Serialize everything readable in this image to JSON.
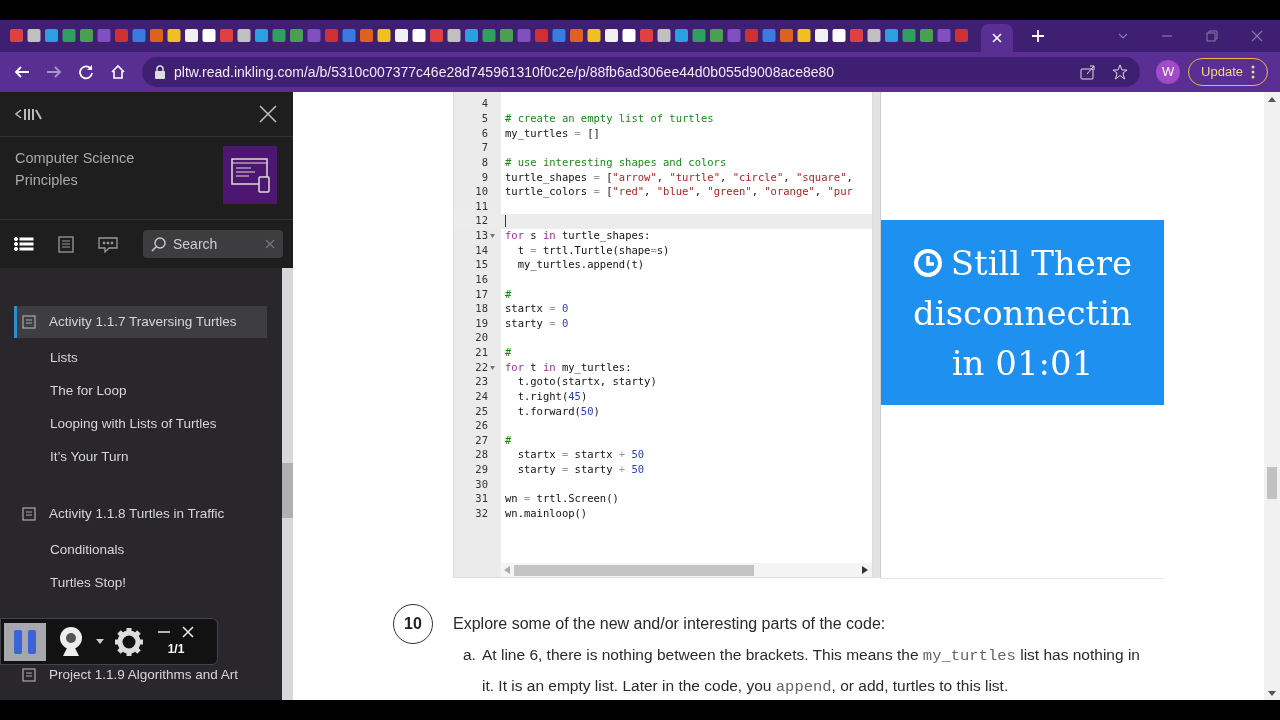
{
  "browser": {
    "address_bar": {
      "url": "pltw.read.inkling.com/a/b/5310c007377c46e28d745961310f0c2e/p/88fb6ad306ee44d0b055d9008ace8e80"
    },
    "profile": "W",
    "update_button": "Update"
  },
  "sidebar": {
    "title": "Computer Science Principles",
    "toolbar": [
      {
        "kind": "list",
        "selected": true
      },
      {
        "kind": "page",
        "selected": false
      },
      {
        "kind": "comment",
        "selected": false
      }
    ],
    "search": {
      "placeholder": "Search"
    },
    "toc": [
      {
        "title": "Activity 1.1.7 Traversing Turtles",
        "selected": true,
        "children": [
          {
            "title": "Lists"
          },
          {
            "title": "The for Loop"
          },
          {
            "title": "Looping with Lists of Turtles"
          },
          {
            "title": "It’s Your Turn"
          }
        ]
      },
      {
        "title": "Activity 1.1.8 Turtles in Traffic",
        "selected": false,
        "children": [
          {
            "title": "Conditionals"
          },
          {
            "title": "Turtles Stop!"
          }
        ]
      },
      {
        "title": "Project 1.1.9 Algorithms and Art",
        "selected": false
      }
    ]
  },
  "recorder": {
    "counter": "1/1"
  },
  "editor": {
    "lines": [
      {
        "number": "4",
        "current": false,
        "foldable": false
      },
      {
        "number": "5",
        "current": false,
        "foldable": false,
        "tokens": [
          {
            "kind": "comment",
            "text": "# create an empty list of turtles"
          }
        ]
      },
      {
        "number": "6",
        "current": false,
        "foldable": false,
        "tokens": [
          {
            "kind": "plain",
            "text": "my_turtles "
          },
          {
            "kind": "op",
            "text": "="
          },
          {
            "kind": "plain",
            "text": " []"
          }
        ]
      },
      {
        "number": "7",
        "current": false,
        "foldable": false
      },
      {
        "number": "8",
        "current": false,
        "foldable": false,
        "tokens": [
          {
            "kind": "comment",
            "text": "# use interesting shapes and colors"
          }
        ]
      },
      {
        "number": "9",
        "current": false,
        "foldable": false,
        "tokens": [
          {
            "kind": "plain",
            "text": "turtle_shapes "
          },
          {
            "kind": "op",
            "text": "="
          },
          {
            "kind": "plain",
            "text": " ["
          },
          {
            "kind": "string",
            "text": "\"arrow\""
          },
          {
            "kind": "plain",
            "text": ", "
          },
          {
            "kind": "string",
            "text": "\"turtle\""
          },
          {
            "kind": "plain",
            "text": ", "
          },
          {
            "kind": "string",
            "text": "\"circle\""
          },
          {
            "kind": "plain",
            "text": ", "
          },
          {
            "kind": "string",
            "text": "\"square\""
          },
          {
            "kind": "plain",
            "text": ","
          }
        ]
      },
      {
        "number": "10",
        "current": false,
        "foldable": false,
        "tokens": [
          {
            "kind": "plain",
            "text": "turtle_colors "
          },
          {
            "kind": "op",
            "text": "="
          },
          {
            "kind": "plain",
            "text": " ["
          },
          {
            "kind": "string",
            "text": "\"red\""
          },
          {
            "kind": "plain",
            "text": ", "
          },
          {
            "kind": "string",
            "text": "\"blue\""
          },
          {
            "kind": "plain",
            "text": ", "
          },
          {
            "kind": "string",
            "text": "\"green\""
          },
          {
            "kind": "plain",
            "text": ", "
          },
          {
            "kind": "string",
            "text": "\"orange\""
          },
          {
            "kind": "plain",
            "text": ", "
          },
          {
            "kind": "string",
            "text": "\"pur"
          }
        ]
      },
      {
        "number": "11",
        "current": false,
        "foldable": false
      },
      {
        "number": "12",
        "current": true,
        "foldable": false
      },
      {
        "number": "13",
        "current": false,
        "foldable": true,
        "tokens": [
          {
            "kind": "keyword",
            "text": "for"
          },
          {
            "kind": "plain",
            "text": " s "
          },
          {
            "kind": "keyword",
            "text": "in"
          },
          {
            "kind": "plain",
            "text": " turtle_shapes:"
          }
        ]
      },
      {
        "number": "14",
        "current": false,
        "foldable": false,
        "tokens": [
          {
            "kind": "plain",
            "text": "  t "
          },
          {
            "kind": "op",
            "text": "="
          },
          {
            "kind": "plain",
            "text": " trtl.Turtle(shape"
          },
          {
            "kind": "op",
            "text": "="
          },
          {
            "kind": "plain",
            "text": "s)"
          }
        ]
      },
      {
        "number": "15",
        "current": false,
        "foldable": false,
        "tokens": [
          {
            "kind": "plain",
            "text": "  my_turtles.append(t)"
          }
        ]
      },
      {
        "number": "16",
        "current": false,
        "foldable": false
      },
      {
        "number": "17",
        "current": false,
        "foldable": false,
        "tokens": [
          {
            "kind": "comment",
            "text": "#"
          }
        ]
      },
      {
        "number": "18",
        "current": false,
        "foldable": false,
        "tokens": [
          {
            "kind": "plain",
            "text": "startx "
          },
          {
            "kind": "op",
            "text": "= "
          },
          {
            "kind": "number",
            "text": "0"
          }
        ]
      },
      {
        "number": "19",
        "current": false,
        "foldable": false,
        "tokens": [
          {
            "kind": "plain",
            "text": "starty "
          },
          {
            "kind": "op",
            "text": "= "
          },
          {
            "kind": "number",
            "text": "0"
          }
        ]
      },
      {
        "number": "20",
        "current": false,
        "foldable": false
      },
      {
        "number": "21",
        "current": false,
        "foldable": false,
        "tokens": [
          {
            "kind": "comment",
            "text": "#"
          }
        ]
      },
      {
        "number": "22",
        "current": false,
        "foldable": true,
        "tokens": [
          {
            "kind": "keyword",
            "text": "for"
          },
          {
            "kind": "plain",
            "text": " t "
          },
          {
            "kind": "keyword",
            "text": "in"
          },
          {
            "kind": "plain",
            "text": " my_turtles:"
          }
        ]
      },
      {
        "number": "23",
        "current": false,
        "foldable": false,
        "tokens": [
          {
            "kind": "plain",
            "text": "  t.goto(startx, starty)"
          }
        ]
      },
      {
        "number": "24",
        "current": false,
        "foldable": false,
        "tokens": [
          {
            "kind": "plain",
            "text": "  t.right("
          },
          {
            "kind": "number",
            "text": "45"
          },
          {
            "kind": "plain",
            "text": ")"
          }
        ]
      },
      {
        "number": "25",
        "current": false,
        "foldable": false,
        "tokens": [
          {
            "kind": "plain",
            "text": "  t.forward("
          },
          {
            "kind": "number",
            "text": "50"
          },
          {
            "kind": "plain",
            "text": ")"
          }
        ]
      },
      {
        "number": "26",
        "current": false,
        "foldable": false
      },
      {
        "number": "27",
        "current": false,
        "foldable": false,
        "tokens": [
          {
            "kind": "comment",
            "text": "#"
          }
        ]
      },
      {
        "number": "28",
        "current": false,
        "foldable": false,
        "tokens": [
          {
            "kind": "plain",
            "text": "  startx "
          },
          {
            "kind": "op",
            "text": "="
          },
          {
            "kind": "plain",
            "text": " startx "
          },
          {
            "kind": "op",
            "text": "+ "
          },
          {
            "kind": "number",
            "text": "50"
          }
        ]
      },
      {
        "number": "29",
        "current": false,
        "foldable": false,
        "tokens": [
          {
            "kind": "plain",
            "text": "  starty "
          },
          {
            "kind": "op",
            "text": "="
          },
          {
            "kind": "plain",
            "text": " starty "
          },
          {
            "kind": "op",
            "text": "+ "
          },
          {
            "kind": "number",
            "text": "50"
          }
        ]
      },
      {
        "number": "30",
        "current": false,
        "foldable": false
      },
      {
        "number": "31",
        "current": false,
        "foldable": false,
        "tokens": [
          {
            "kind": "plain",
            "text": "wn "
          },
          {
            "kind": "op",
            "text": "="
          },
          {
            "kind": "plain",
            "text": " trtl.Screen()"
          }
        ]
      },
      {
        "number": "32",
        "current": false,
        "foldable": false,
        "tokens": [
          {
            "kind": "plain",
            "text": "wn.mainloop()"
          }
        ]
      }
    ]
  },
  "timeout_banner": {
    "lines": [
      "Still There",
      "disconnectin",
      "in 01:01"
    ]
  },
  "step": {
    "number": "10",
    "text": "Explore some of the new and/or interesting parts of the code:",
    "items": [
      {
        "label": "a.",
        "segments": [
          {
            "kind": "text",
            "text": "At line 6, there is nothing between the brackets. This means the "
          },
          {
            "kind": "code",
            "text": "my_turtles"
          },
          {
            "kind": "text",
            "text": " list has nothing in it. It is an empty list. Later in the code, you "
          },
          {
            "kind": "code",
            "text": "append"
          },
          {
            "kind": "text",
            "text": ", or add, turtles to this list."
          }
        ]
      }
    ]
  }
}
